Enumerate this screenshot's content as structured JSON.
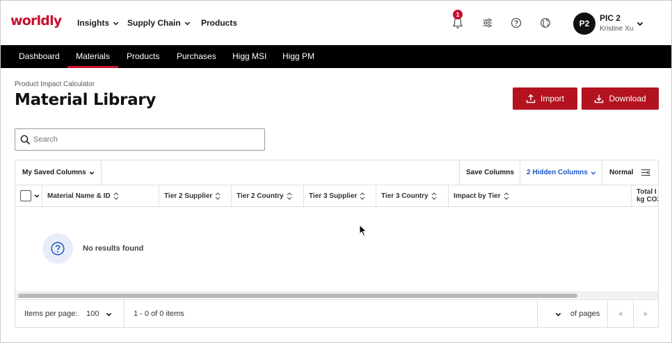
{
  "brand": {
    "logo_text": "worldly",
    "accent": "#c8102e"
  },
  "top_nav": {
    "items": [
      {
        "label": "Insights",
        "has_dropdown": true
      },
      {
        "label": "Supply Chain",
        "has_dropdown": true
      },
      {
        "label": "Products",
        "has_dropdown": false
      }
    ]
  },
  "header": {
    "notification_count": "1",
    "icons": [
      "bell-icon",
      "sliders-icon",
      "help-icon",
      "globe-icon"
    ],
    "user": {
      "initials": "P2",
      "name": "PIC 2",
      "subtitle": "Kristine Xu"
    }
  },
  "sub_nav": {
    "items": [
      {
        "label": "Dashboard",
        "active": false
      },
      {
        "label": "Materials",
        "active": true
      },
      {
        "label": "Products",
        "active": false
      },
      {
        "label": "Purchases",
        "active": false
      },
      {
        "label": "Higg MSI",
        "active": false
      },
      {
        "label": "Higg PM",
        "active": false
      }
    ]
  },
  "page": {
    "breadcrumb": "Product Impact Calculator",
    "title": "Material Library",
    "import_label": "Import",
    "download_label": "Download"
  },
  "search": {
    "placeholder": "Search",
    "value": ""
  },
  "grid": {
    "saved_columns_label": "My Saved Columns",
    "save_columns_label": "Save Columns",
    "hidden_columns_label": "2 Hidden Columns",
    "density_label": "Normal",
    "columns": [
      "Material Name & ID",
      "Tier 2 Supplier",
      "Tier 2 Country",
      "Tier 3 Supplier",
      "Tier 3 Country",
      "Impact by Tier",
      "Total I",
      "kg CO2"
    ],
    "empty_message": "No results found"
  },
  "pagination": {
    "items_per_page_label": "Items per page:",
    "items_per_page": "100",
    "range_text": "1 - 0 of 0 items",
    "current_page": "",
    "of_pages_text": "of pages"
  }
}
